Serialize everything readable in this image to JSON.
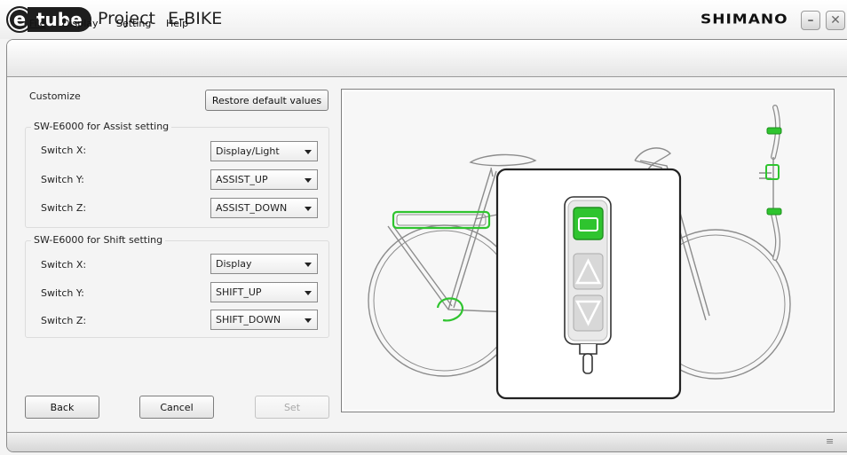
{
  "app": {
    "logo_letter": "e",
    "logo_word": "tube",
    "title": "Project",
    "subtitle": "E-BIKE",
    "brand": "SHIMANO",
    "minimize_icon": "minimize-icon",
    "close_icon": "close-icon"
  },
  "menu": [
    {
      "label": "File"
    },
    {
      "label": "Display"
    },
    {
      "label": "Setting"
    },
    {
      "label": "Help"
    }
  ],
  "left": {
    "customize_label": "Customize",
    "restore_button": "Restore default values",
    "assist_group": {
      "title": "SW-E6000 for Assist setting",
      "rows": [
        {
          "label": "Switch X:",
          "value": "Display/Light"
        },
        {
          "label": "Switch Y:",
          "value": "ASSIST_UP"
        },
        {
          "label": "Switch Z:",
          "value": "ASSIST_DOWN"
        }
      ]
    },
    "shift_group": {
      "title": "SW-E6000 for Shift setting",
      "rows": [
        {
          "label": "Switch X:",
          "value": "Display"
        },
        {
          "label": "Switch Y:",
          "value": "SHIFT_UP"
        },
        {
          "label": "Switch Z:",
          "value": "SHIFT_DOWN"
        }
      ]
    },
    "back_button": "Back",
    "cancel_button": "Cancel",
    "set_button": "Set"
  },
  "illustration": {
    "highlight_color": "#2fc42f",
    "outline_color": "#8c8c8c",
    "icons": [
      "bicycle-illustration",
      "handlebar-diagram",
      "switch-closeup"
    ]
  },
  "statusbar": {
    "grip_icon": "resize-grip-icon"
  }
}
